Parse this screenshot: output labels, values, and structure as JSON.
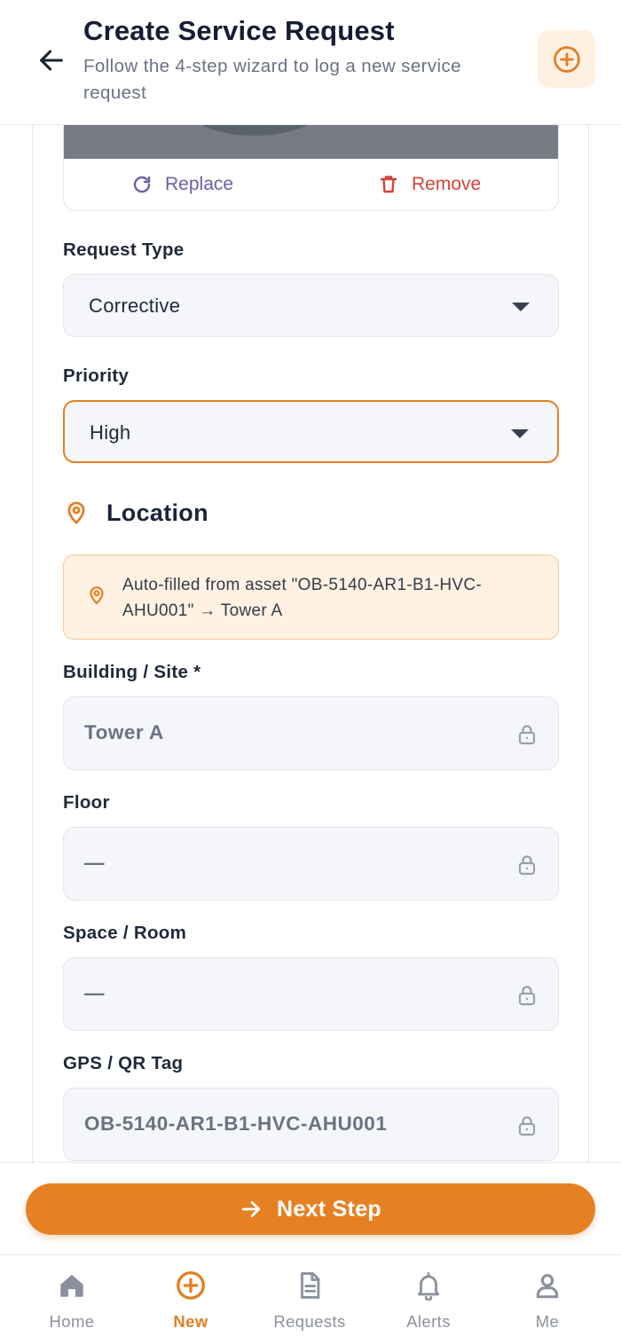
{
  "header": {
    "title": "Create Service Request",
    "subtitle": "Follow the 4-step wizard to log a new service request"
  },
  "photo": {
    "replace_label": "Replace",
    "remove_label": "Remove"
  },
  "form": {
    "request_type": {
      "label": "Request Type",
      "value": "Corrective"
    },
    "priority": {
      "label": "Priority",
      "value": "High"
    }
  },
  "location": {
    "title": "Location",
    "autofill_note": "Auto-filled from asset \"OB-5140-AR1-B1-HVC-AHU001\" → Tower A",
    "building": {
      "label": "Building / Site *",
      "value": "Tower A"
    },
    "floor": {
      "label": "Floor",
      "value": "—"
    },
    "space": {
      "label": "Space / Room",
      "value": "—"
    },
    "gps": {
      "label": "GPS / QR Tag",
      "value": "OB-5140-AR1-B1-HVC-AHU001"
    }
  },
  "actions": {
    "next_label": "Next Step"
  },
  "nav": {
    "items": [
      {
        "label": "Home",
        "icon": "home-icon"
      },
      {
        "label": "New",
        "icon": "plus-circle-icon",
        "active": true
      },
      {
        "label": "Requests",
        "icon": "document-icon"
      },
      {
        "label": "Alerts",
        "icon": "bell-icon"
      },
      {
        "label": "Me",
        "icon": "user-icon"
      }
    ]
  },
  "colors": {
    "accent": "#e68123",
    "danger": "#d9403a",
    "replace": "#6b5fa5",
    "info_bg": "#fff2e2"
  }
}
